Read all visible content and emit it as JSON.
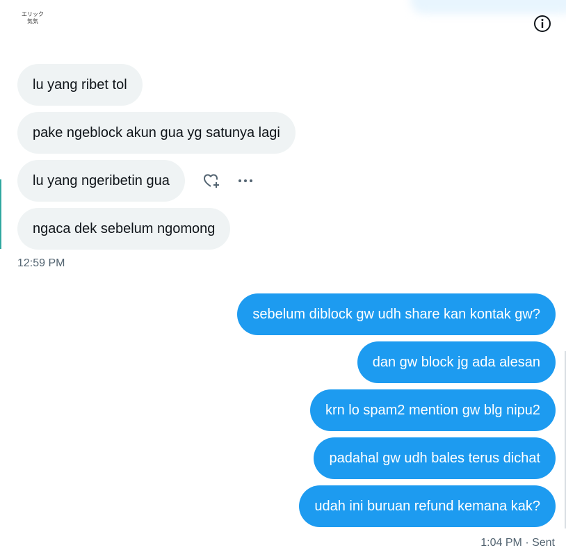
{
  "header": {
    "avatar_line1": "エリック",
    "avatar_line2": "気気",
    "info_icon": "info-icon"
  },
  "received": {
    "messages": [
      "lu yang ribet tol",
      "pake ngeblock akun gua yg satunya lagi",
      "lu yang ngeribetin gua",
      "ngaca dek sebelum ngomong"
    ],
    "timestamp": "12:59 PM",
    "hover_actions": [
      "add-reaction-icon",
      "more-icon"
    ]
  },
  "sent": {
    "messages": [
      "sebelum diblock gw udh share kan kontak gw?",
      "dan gw block jg ada alesan",
      "krn lo spam2 mention gw blg nipu2",
      "padahal gw udh bales terus dichat",
      "udah ini buruan refund kemana kak?"
    ],
    "timestamp": "1:04 PM · Sent"
  },
  "colors": {
    "sent_bubble": "#1d9bf0",
    "received_bubble": "#eff3f4",
    "text": "#0f1419",
    "meta_text": "#536471"
  }
}
